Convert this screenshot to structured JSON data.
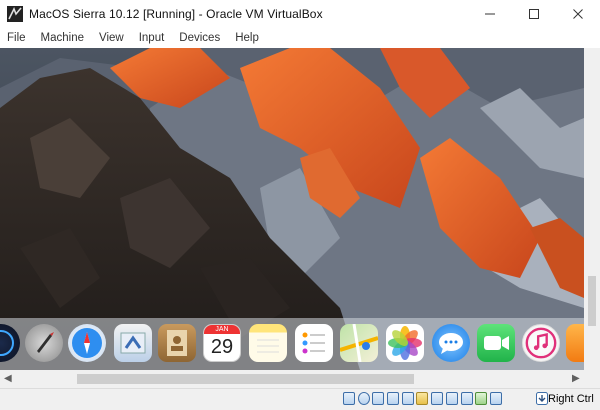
{
  "window": {
    "title": "MacOS Sierra 10.12 [Running] - Oracle VM VirtualBox",
    "controls": [
      "minimize-icon",
      "maximize-icon",
      "close-icon"
    ]
  },
  "menu": {
    "items": [
      "File",
      "Machine",
      "View",
      "Input",
      "Devices",
      "Help"
    ]
  },
  "guest": {
    "wallpaper": "macos-sierra-mountain",
    "dock": {
      "icons": [
        "siri-icon",
        "launchpad-icon",
        "safari-icon",
        "mail-icon",
        "contacts-icon",
        "calendar-icon",
        "notes-icon",
        "reminders-icon",
        "maps-icon",
        "photos-icon",
        "messages-icon",
        "facetime-icon",
        "itunes-icon",
        "ibooks-icon"
      ],
      "calendar": {
        "month": "JAN",
        "day": "29"
      }
    }
  },
  "status_bar": {
    "icons": [
      "hard-disk-icon",
      "optical-drive-icon",
      "audio-icon",
      "network-icon",
      "usb-icon",
      "shared-folders-icon",
      "display-icon",
      "video-capture-icon",
      "cpu-icon",
      "mouse-integration-icon",
      "recording-icon"
    ],
    "host_key": "Right Ctrl"
  },
  "colors": {
    "titlebar_bg": "#ffffff",
    "statusbar_bg": "#f0f0f0",
    "scrollbar_thumb": "#cdcdcd",
    "mountain_orange": "#e8642a",
    "mountain_shadow": "#2b2623"
  }
}
